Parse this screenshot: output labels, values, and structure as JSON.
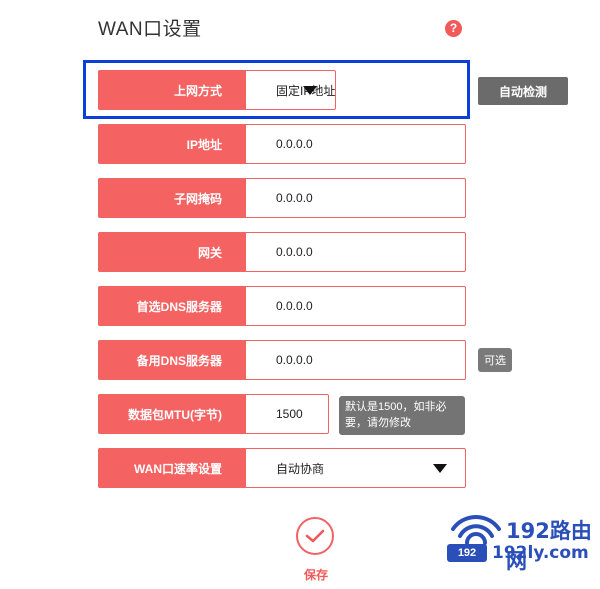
{
  "page": {
    "title": "WAN口设置",
    "help_icon": "?"
  },
  "fields": [
    {
      "label": "上网方式",
      "value": "固定IP地址",
      "type": "select"
    },
    {
      "label": "IP地址",
      "value": "0.0.0.0",
      "type": "input"
    },
    {
      "label": "子网掩码",
      "value": "0.0.0.0",
      "type": "input"
    },
    {
      "label": "网关",
      "value": "0.0.0.0",
      "type": "input"
    },
    {
      "label": "首选DNS服务器",
      "value": "0.0.0.0",
      "type": "input"
    },
    {
      "label": "备用DNS服务器",
      "value": "0.0.0.0",
      "type": "input"
    },
    {
      "label": "数据包MTU(字节)",
      "value": "1500",
      "type": "input"
    },
    {
      "label": "WAN口速率设置",
      "value": "自动协商",
      "type": "select"
    }
  ],
  "actions": {
    "auto_detect": "自动检测",
    "optional_tag": "可选",
    "mtu_note": "默认是1500，如非必要，请勿修改",
    "save": "保存"
  },
  "watermark": {
    "brand": "192路由网",
    "badge": "192",
    "domain": "192ly.com"
  },
  "colors": {
    "accent": "#f46262",
    "highlight_border": "#0a3fd8",
    "gray_button": "#6b6b6b",
    "watermark": "#2a4fb8"
  },
  "icons": {
    "help": "question-circle-icon",
    "dropdown": "caret-down-icon",
    "save": "check-circle-icon",
    "watermark": "wifi-icon"
  }
}
